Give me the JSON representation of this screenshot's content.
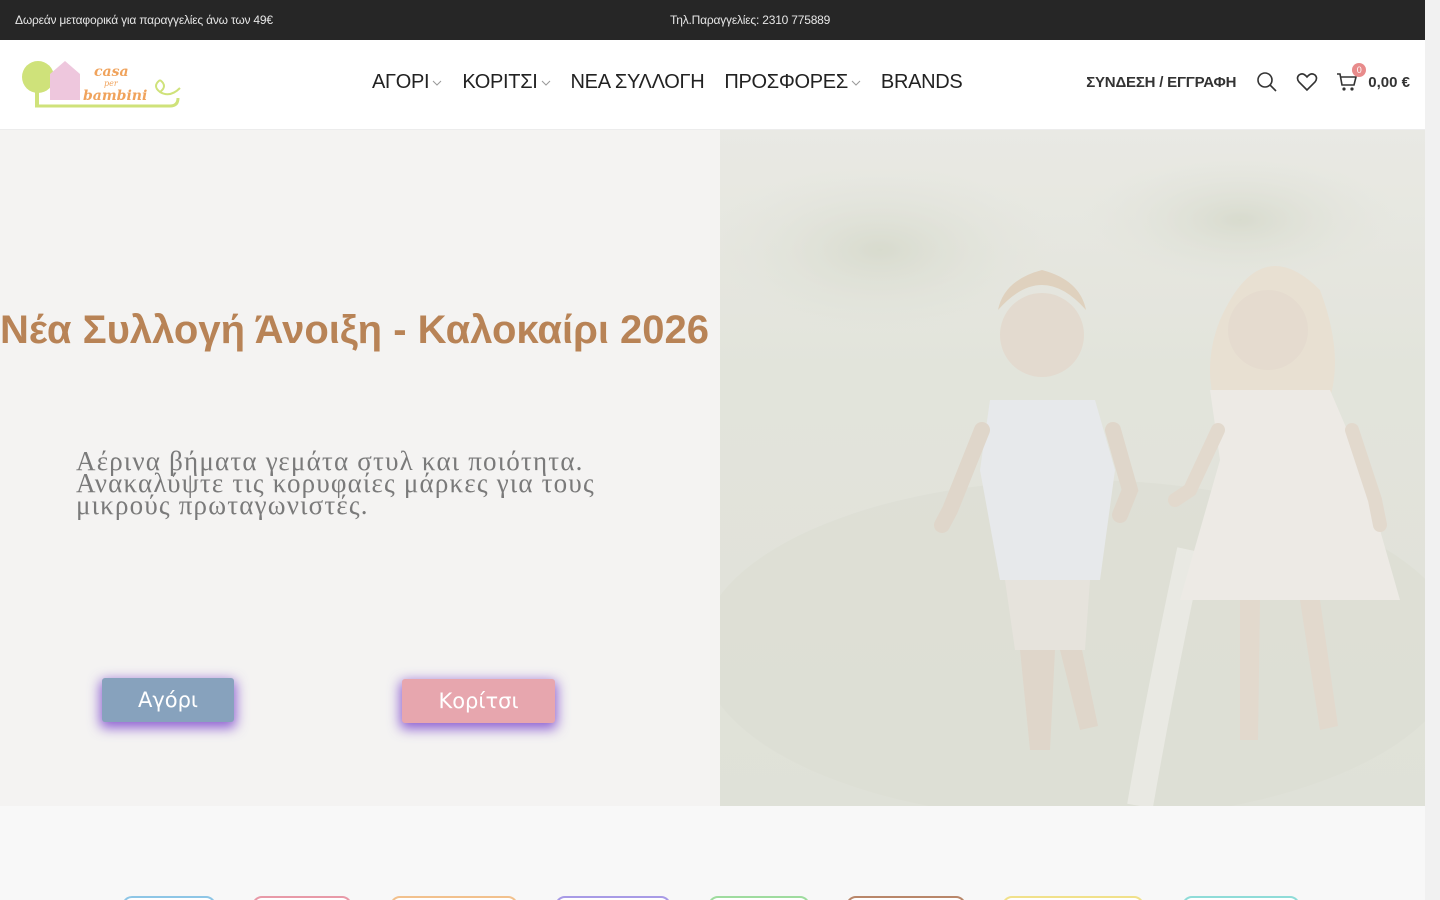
{
  "topbar": {
    "shipping_text": "Δωρεάν μεταφορικά για παραγγελίες άνω των 49€",
    "phone_text": "Τηλ.Παραγγελίες: 2310 775889"
  },
  "logo": {
    "line1": "casa",
    "line2": "per",
    "line3": "bambini"
  },
  "nav": {
    "items": [
      {
        "label": "ΑΓΟΡΙ",
        "has_dropdown": true
      },
      {
        "label": "ΚΟΡΙΤΣΙ",
        "has_dropdown": true
      },
      {
        "label": "ΝΕΑ ΣΥΛΛΟΓΗ",
        "has_dropdown": false
      },
      {
        "label": "ΠΡΟΣΦΟΡΕΣ",
        "has_dropdown": true
      },
      {
        "label": "BRANDS",
        "has_dropdown": false
      }
    ]
  },
  "header_right": {
    "login_label": "ΣΥΝΔΕΣΗ / ΕΓΓΡΑΦΗ",
    "search_icon": "search-icon",
    "wishlist_icon": "heart-icon",
    "cart_icon": "cart-icon",
    "cart_count": "0",
    "cart_total": "0,00 €"
  },
  "hero": {
    "title": "Νέα Συλλογή Άνοιξη - Καλοκαίρι 2026",
    "subtitle": "Αέρινα βήματα γεμάτα στυλ και ποιότητα. Ανακαλύψτε τις κορυφαίες μάρκες για τους μικρούς πρωταγωνιστές.",
    "boy_button": "Αγόρι",
    "girl_button": "Κορίτσι"
  },
  "colors": {
    "topbar_bg": "#262626",
    "hero_title": "#b88356",
    "boy_button": "#87a2bd",
    "girl_button": "#e7a6ae",
    "button_glow": "#6e32c8"
  },
  "category_pills_colors": [
    "#8ec6e6",
    "#e89aa8",
    "#f2c18d",
    "#a89be6",
    "#9fdc9f",
    "#b9876a",
    "#f1e18b",
    "#8fdcd8"
  ]
}
